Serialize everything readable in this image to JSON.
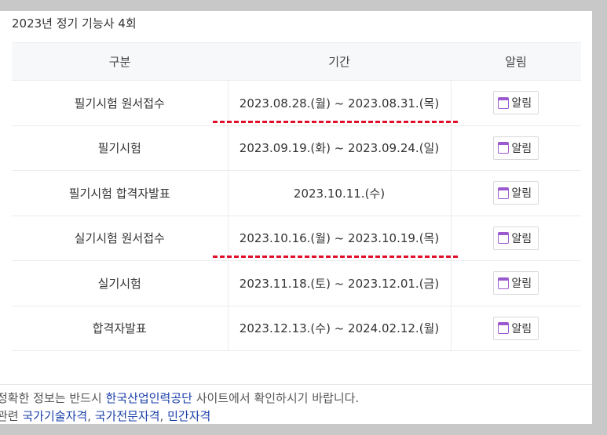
{
  "section_title": "2023년 정기 기능사 4회",
  "table": {
    "headers": [
      "구분",
      "기간",
      "알림"
    ],
    "rows": [
      {
        "category": "필기시험 원서접수",
        "period": "2023.08.28.(월) ~ 2023.08.31.(목)",
        "alarm": "알림"
      },
      {
        "category": "필기시험",
        "period": "2023.09.19.(화) ~ 2023.09.24.(일)",
        "alarm": "알림"
      },
      {
        "category": "필기시험 합격자발표",
        "period": "2023.10.11.(수)",
        "alarm": "알림"
      },
      {
        "category": "실기시험 원서접수",
        "period": "2023.10.16.(월) ~ 2023.10.19.(목)",
        "alarm": "알림"
      },
      {
        "category": "실기시험",
        "period": "2023.11.18.(토) ~ 2023.12.01.(금)",
        "alarm": "알림"
      },
      {
        "category": "합격자발표",
        "period": "2023.12.13.(수) ~ 2024.02.12.(월)",
        "alarm": "알림"
      }
    ]
  },
  "notice": {
    "prefix": "정확한 정보는 반드시 ",
    "link": "한국산업인력공단",
    "suffix": " 사이트에서 확인하시기 바랍니다."
  },
  "related": {
    "label": "관련 ",
    "links": [
      "국가기술자격",
      "국가전문자격",
      "민간자격"
    ],
    "separator": ", "
  },
  "colors": {
    "underline": "#e0102a",
    "link": "#1a3fa8",
    "calendar_icon": "#9b59d0",
    "header_bg": "#f7f8fa"
  },
  "icons": {
    "alarm": "calendar-icon"
  },
  "highlighted_rows": [
    0,
    3
  ]
}
